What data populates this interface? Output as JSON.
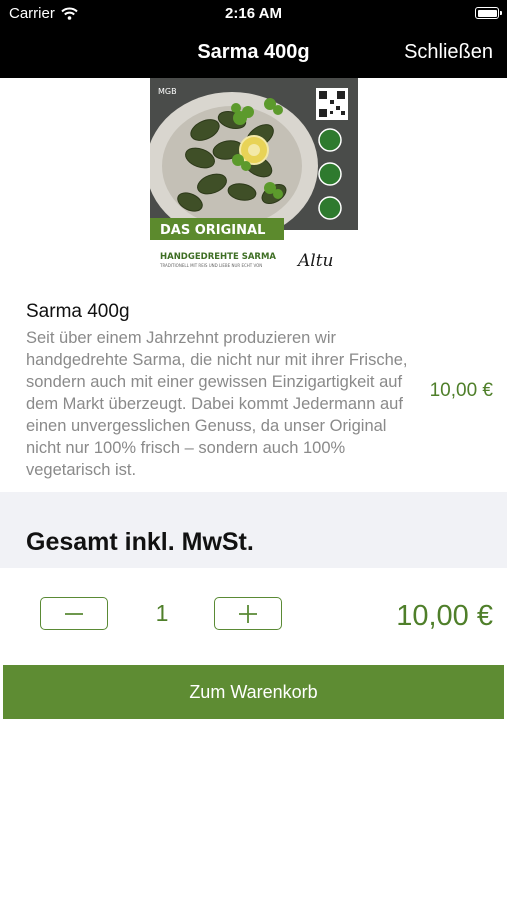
{
  "status_bar": {
    "carrier": "Carrier",
    "time": "2:16 AM"
  },
  "nav": {
    "title": "Sarma 400g",
    "close_label": "Schließen"
  },
  "image": {
    "brand_badge": "MGB",
    "banner": "DAS ORIGINAL",
    "caption_title": "HANDGEDREHTE SARMA",
    "caption_sub": "TRADITIONELL MIT REIS UND LIEBE NUR ECHT VON",
    "signature": "Altu"
  },
  "product": {
    "name": "Sarma 400g",
    "description": "Seit über einem Jahrzehnt produzieren wir handgedrehte Sarma, die nicht nur mit ihrer Frische, sondern auch mit einer gewissen Einzigartigkeit auf dem Markt überzeugt. Dabei kommt Jedermann auf einen unvergesslichen Genuss, da unser Original nicht nur 100% frisch – sondern auch 100% vegetarisch ist.",
    "price": "10,00 €"
  },
  "total": {
    "label": "Gesamt inkl. MwSt.",
    "quantity": "1",
    "price": "10,00 €"
  },
  "cart_button": {
    "label": "Zum Warenkorb"
  },
  "icons": {
    "wifi": "wifi-icon",
    "battery": "battery-icon",
    "minus": "minus-icon",
    "plus": "plus-icon"
  },
  "colors": {
    "accent": "#5e8c33",
    "price": "#4f7f2a",
    "nav_bg": "#000000",
    "total_bg": "#f1f2f6"
  }
}
